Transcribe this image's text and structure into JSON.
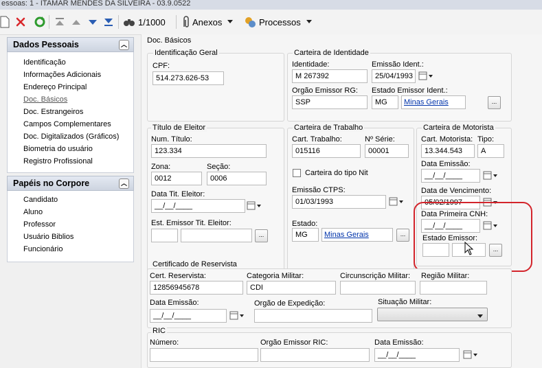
{
  "window": {
    "title": "essoas: 1 - ITAMAR MENDES DA SILVEIRA - 03.9.0522"
  },
  "toolbar": {
    "record_counter": "1/1000",
    "attachments_label": "Anexos",
    "processes_label": "Processos"
  },
  "sidebar": {
    "personal_header": "Dados Pessoais",
    "personal_items": [
      "Identificação",
      "Informações Adicionais",
      "Endereço Principal",
      "Doc. Básicos",
      "Doc. Estrangeiros",
      "Campos Complementares",
      "Doc. Digitalizados (Gráficos)",
      "Biometria do usuário",
      "Registro Profissional"
    ],
    "roles_header": "Papéis no Corpore",
    "roles_items": [
      "Candidato",
      "Aluno",
      "Professor",
      "Usuário Biblios",
      "Funcionário"
    ]
  },
  "page": {
    "title": "Doc. Básicos"
  },
  "ident_geral": {
    "title": "Identificação Geral",
    "cpf_label": "CPF:",
    "cpf_value": "514.273.626-53"
  },
  "carteira_ident": {
    "title": "Carteira de Identidade",
    "identidade_label": "Identidade:",
    "identidade_value": "M 267392",
    "emissao_label": "Emissão Ident.:",
    "emissao_value": "25/04/1993",
    "orgao_label": "Orgão Emissor RG:",
    "orgao_value": "SSP",
    "estado_label": "Estado Emissor Ident.:",
    "estado_value": "MG",
    "estado_link": "Minas Gerais"
  },
  "titulo_eleitor": {
    "title": "Título de Eleitor",
    "num_label": "Num. Título:",
    "num_value": "123.334",
    "zona_label": "Zona:",
    "zona_value": "0012",
    "secao_label": "Seção:",
    "secao_value": "0006",
    "data_label": "Data Tit. Eleitor:",
    "data_value": "__/__/____",
    "est_label": "Est. Emissor Tit. Eleitor:"
  },
  "carteira_trabalho": {
    "title": "Carteira de Trabalho",
    "cart_label": "Cart. Trabalho:",
    "cart_value": "015116",
    "serie_label": "Nº Série:",
    "serie_value": "00001",
    "nit_label": "Carteira do tipo Nit",
    "emissao_label": "Emissão CTPS:",
    "emissao_value": "01/03/1993",
    "estado_label": "Estado:",
    "estado_value": "MG",
    "estado_link": "Minas Gerais"
  },
  "carteira_motorista": {
    "title": "Carteira de Motorista",
    "cart_label": "Cart. Motorista:",
    "cart_value": "13.344.543",
    "tipo_label": "Tipo:",
    "tipo_value": "A",
    "emissao_label": "Data Emissão:",
    "emissao_value": "__/__/____",
    "vencimento_label": "Data de Vencimento:",
    "vencimento_value": "05/02/1997",
    "primeira_label": "Data Primeira CNH:",
    "primeira_value": "__/__/____",
    "estado_label": "Estado Emissor:"
  },
  "reservista": {
    "title": "Certificado de Reservista",
    "cert_label": "Cert. Reservista:",
    "cert_value": "12856945678",
    "categoria_label": "Categoria Militar:",
    "categoria_value": "CDI",
    "circ_label": "Circunscrição Militar:",
    "regiao_label": "Região Militar:",
    "data_label": "Data Emissão:",
    "data_value": "__/__/____",
    "orgao_label": "Orgão de Expedição:",
    "situacao_label": "Situação Militar:"
  },
  "ric": {
    "title": "RIC",
    "numero_label": "Número:",
    "orgao_label": "Orgão Emissor RIC:",
    "data_label": "Data Emissão:",
    "data_value": "__/__/____"
  },
  "colors": {
    "highlight": "#d3242b",
    "link": "#0033aa"
  }
}
